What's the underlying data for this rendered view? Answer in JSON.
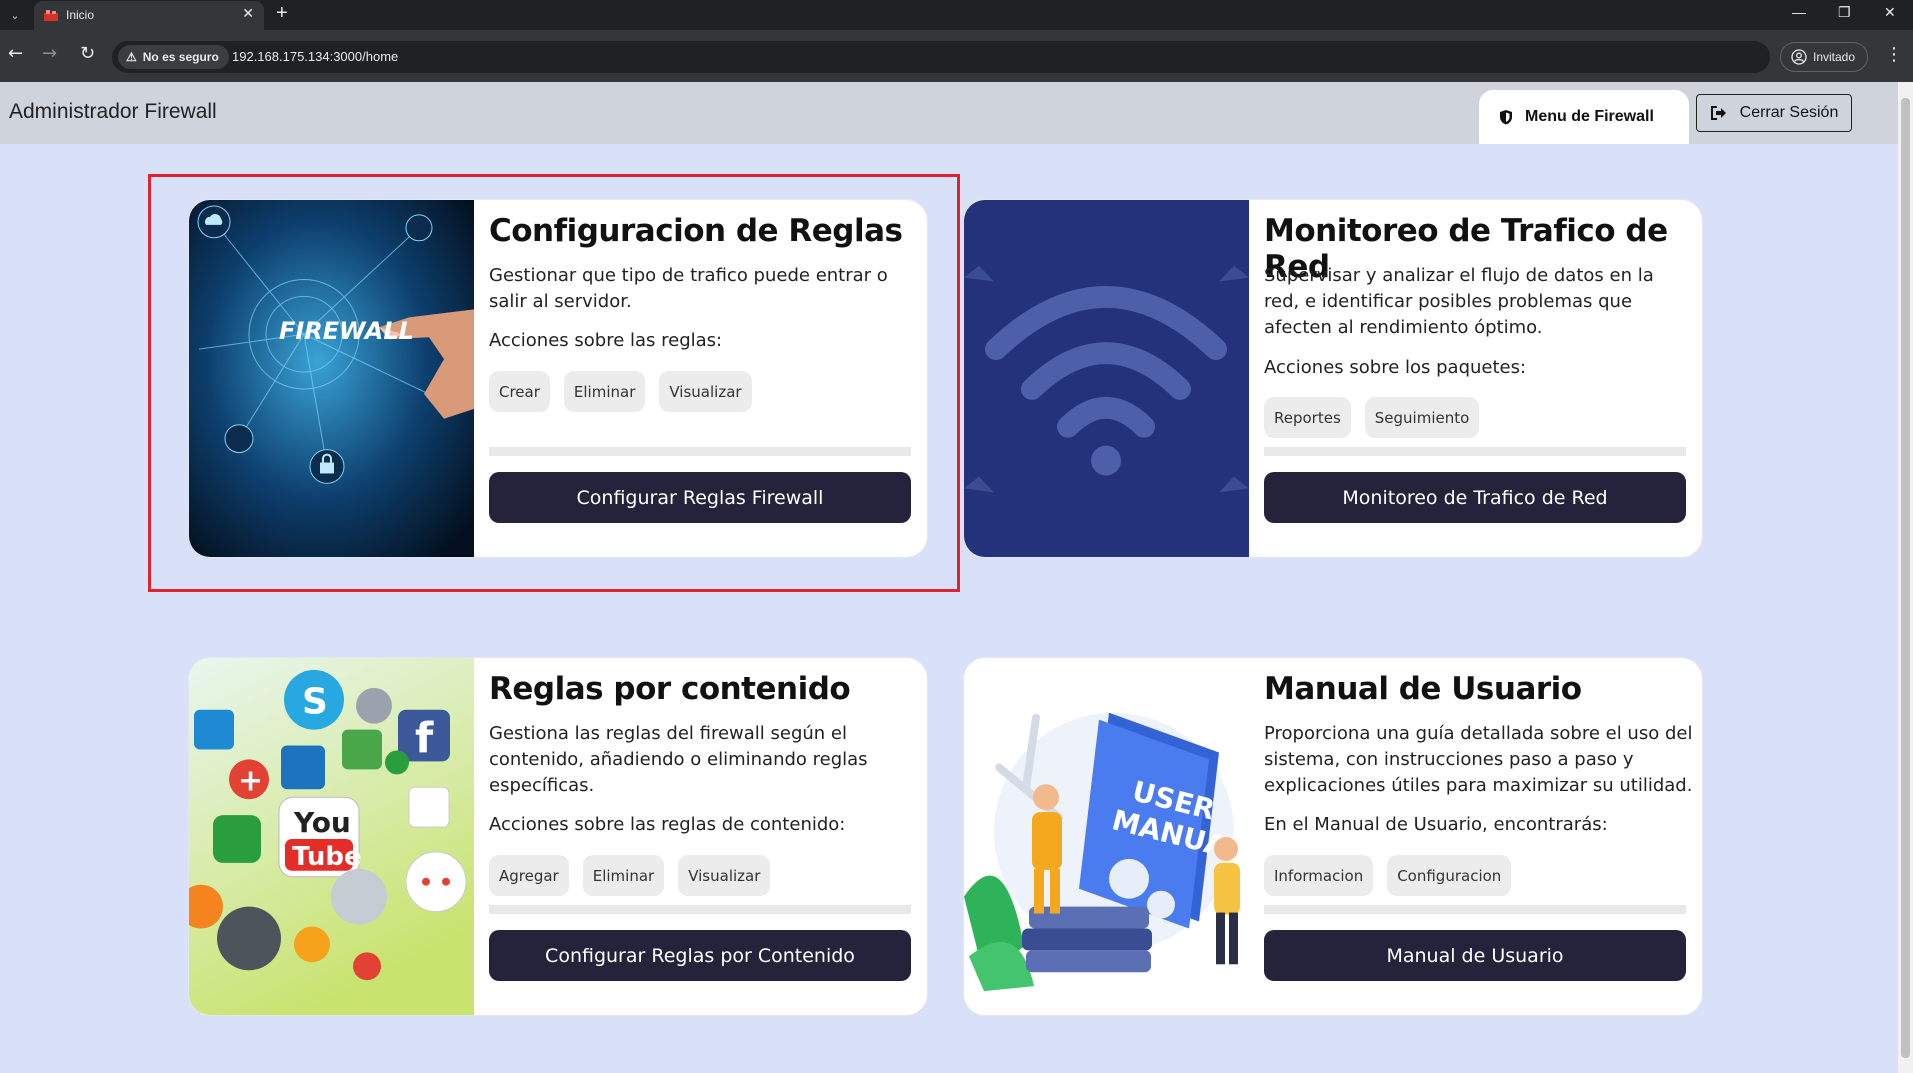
{
  "browser": {
    "tab_title": "Inicio",
    "new_tab_symbol": "+",
    "security_label": "No es seguro",
    "url": "192.168.175.134:3000/home",
    "profile_label": "Invitado"
  },
  "app": {
    "title": "Administrador Firewall",
    "menu_tab_label": "Menu de Firewall",
    "logout_label": "Cerrar Sesión"
  },
  "cards": [
    {
      "title": "Configuracion de Reglas",
      "description": "Gestionar que tipo de trafico puede entrar o salir al servidor.",
      "actions_heading": "Acciones sobre las reglas:",
      "chips": [
        "Crear",
        "Eliminar",
        "Visualizar"
      ],
      "button": "Configurar Reglas Firewall",
      "image_label": "FIREWALL"
    },
    {
      "title": "Monitoreo de Trafico de Red",
      "description": "Supervisar y analizar el flujo de datos en la red, e identificar posibles problemas que afecten al rendimiento óptimo.",
      "actions_heading": "Acciones sobre los paquetes:",
      "chips": [
        "Reportes",
        "Seguimiento"
      ],
      "button": "Monitoreo de Trafico de Red"
    },
    {
      "title": "Reglas por contenido",
      "description": "Gestiona las reglas del firewall según el contenido, añadiendo o eliminando reglas específicas.",
      "actions_heading": "Acciones sobre las reglas de contenido:",
      "chips": [
        "Agregar",
        "Eliminar",
        "Visualizar"
      ],
      "button": "Configurar Reglas por Contenido",
      "image_labels": [
        "You",
        "Tube"
      ]
    },
    {
      "title": "Manual de Usuario",
      "description": "Proporciona una guía detallada sobre el uso del sistema, con instrucciones paso a paso y explicaciones útiles para maximizar su utilidad.",
      "actions_heading": "En el Manual de Usuario, encontrarás:",
      "chips": [
        "Informacion",
        "Configuracion"
      ],
      "button": "Manual de Usuario",
      "image_labels": [
        "USER",
        "MANUAL"
      ]
    }
  ],
  "colors": {
    "page_bg": "#d8e1f7",
    "appbar_bg": "#cfd3dc",
    "button_bg": "#25223b",
    "highlight": "#e0232e"
  }
}
